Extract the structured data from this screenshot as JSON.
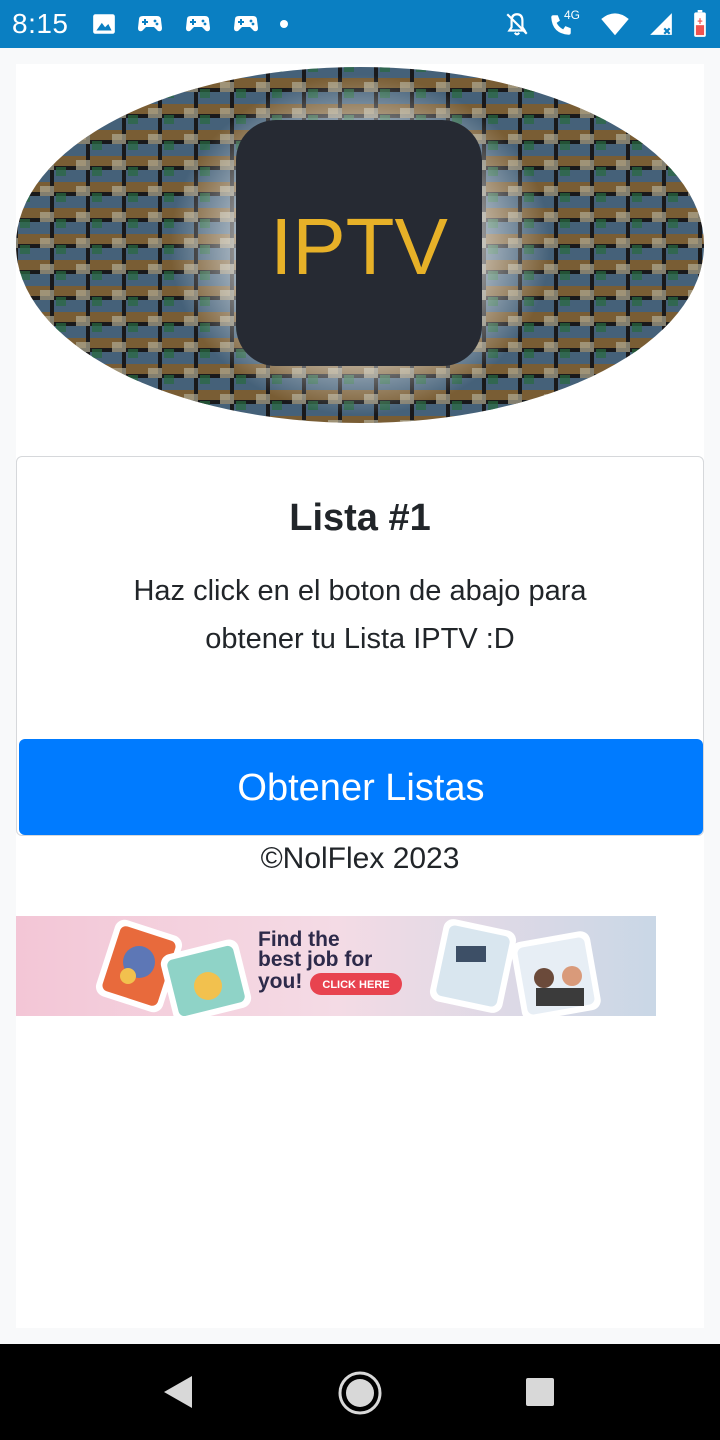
{
  "status_bar": {
    "time": "8:15",
    "left_icons": [
      "image-icon",
      "game-controller-icon",
      "game-controller-icon",
      "game-controller-icon",
      "dot-icon"
    ],
    "right_icons": [
      "bell-off-icon",
      "wifi-calling-4g-icon",
      "wifi-icon",
      "signal-icon",
      "battery-icon"
    ],
    "network_label": "4G",
    "color": "#0a7fc2"
  },
  "banner": {
    "logo_text": "IPTV",
    "logo_color": "#e7b128",
    "logo_bg": "#262a33"
  },
  "card": {
    "title": "Lista #1",
    "text": "Haz click en el boton de abajo para obtener tu Lista IPTV :D",
    "button_label": "Obtener Listas",
    "button_color": "#007bff"
  },
  "footer": {
    "text": "©NolFlex 2023"
  },
  "ad": {
    "headline_line1": "Find the",
    "headline_line2": "best job for",
    "headline_line3": "you!",
    "cta": "CLICK HERE",
    "cta_color": "#e8434f"
  },
  "nav_bar": {
    "buttons": [
      "back-icon",
      "home-icon",
      "recents-icon"
    ]
  }
}
